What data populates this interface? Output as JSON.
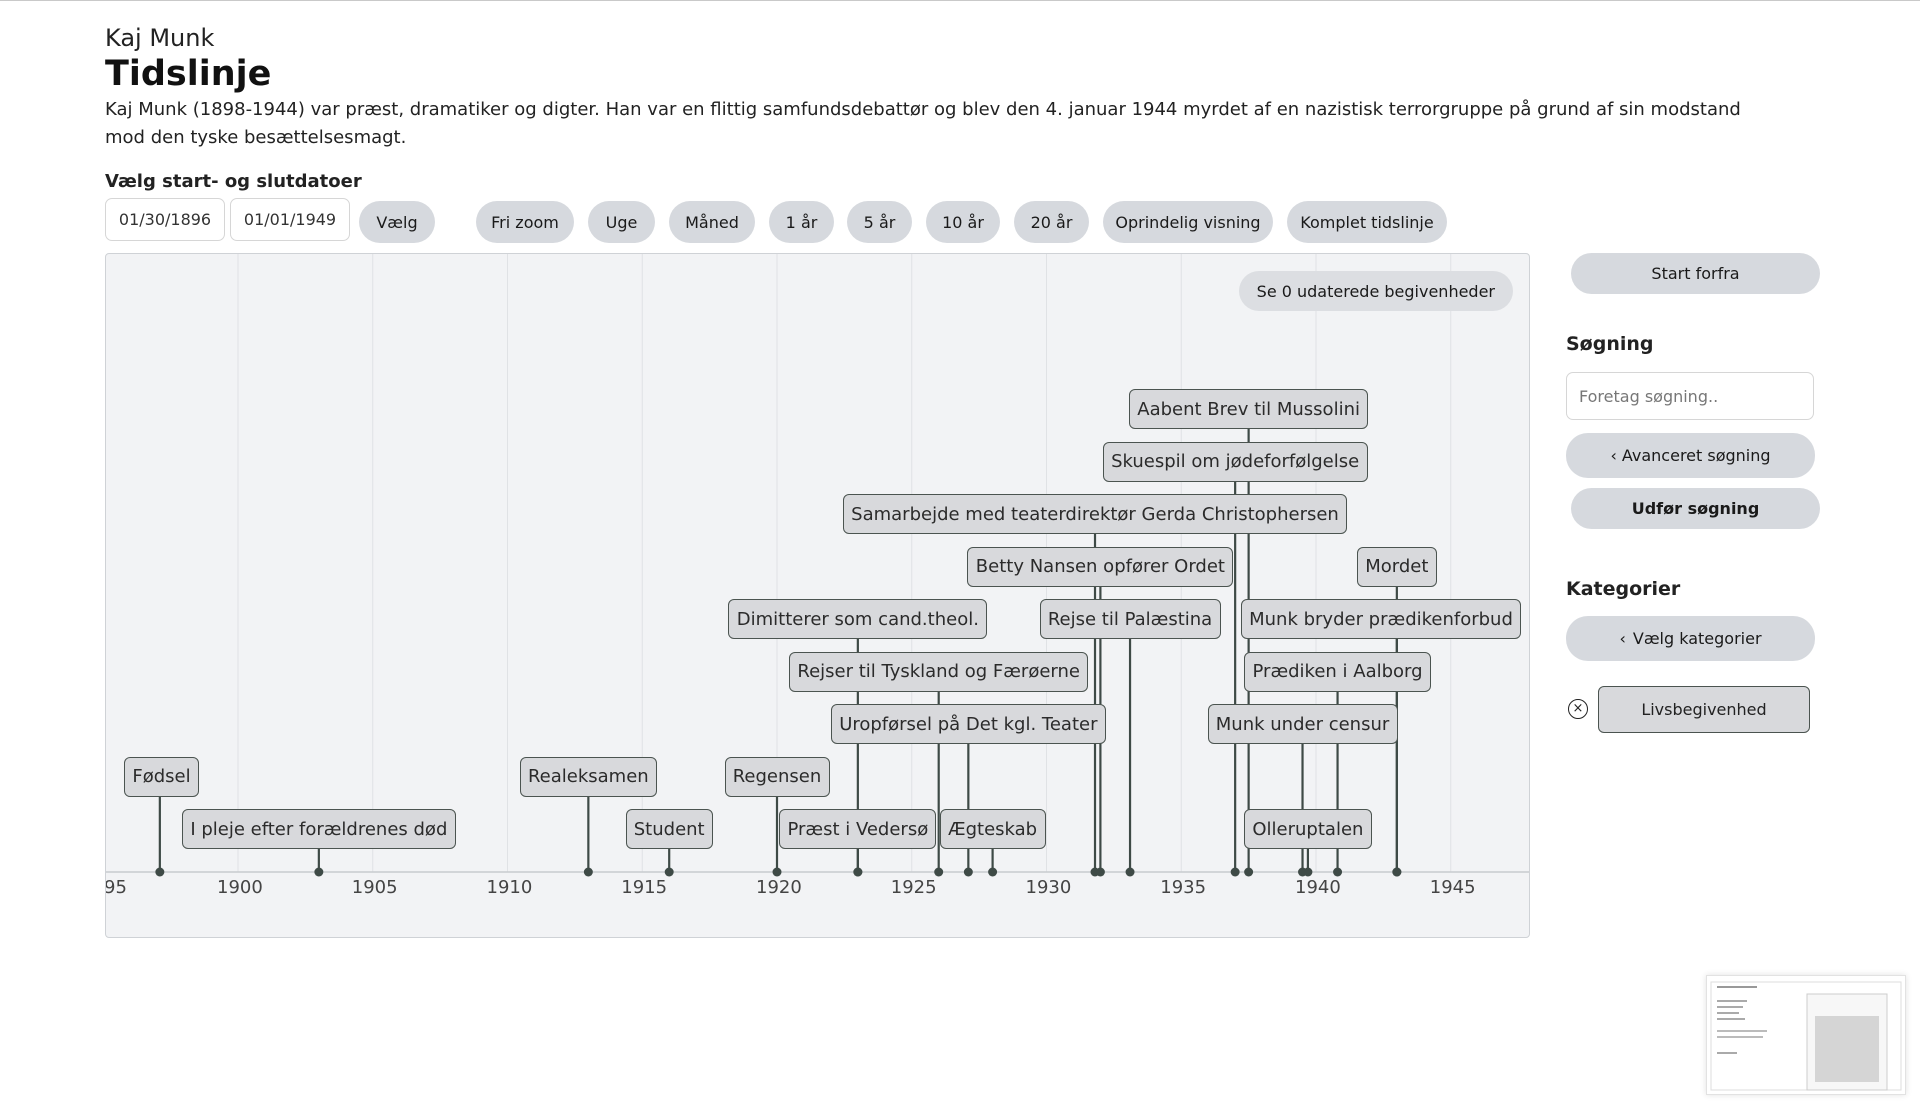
{
  "header": {
    "subtitle": "Kaj Munk",
    "title": "Tidslinje",
    "description": "Kaj Munk (1898-1944) var præst, dramatiker og digter. Han var en flittig samfundsdebattør og blev den 4. januar 1944 myrdet af en nazistisk terrorgruppe på grund af sin modstand mod den tyske besættelsesmagt."
  },
  "date_range": {
    "label": "Vælg start- og slutdatoer",
    "start": "01/30/1896",
    "end": "01/01/1949",
    "select_button": "Vælg"
  },
  "zoom": {
    "buttons": [
      "Fri zoom",
      "Uge",
      "Måned",
      "1 år",
      "5 år",
      "10 år",
      "20 år",
      "Oprindelig visning",
      "Komplet tidslinje"
    ]
  },
  "timeline": {
    "undated_button": "Se 0 udaterede begivenheder",
    "axis_labels": [
      "95",
      "1900",
      "1905",
      "1910",
      "1915",
      "1920",
      "1925",
      "1930",
      "1935",
      "1940",
      "1945"
    ],
    "events": [
      {
        "label": "Fødsel",
        "year": 1897.1,
        "row": 1
      },
      {
        "label": "I pleje efter forældrenes død",
        "year": 1903.0,
        "row": 0
      },
      {
        "label": "Realeksamen",
        "year": 1913.0,
        "row": 1
      },
      {
        "label": "Student",
        "year": 1916.0,
        "row": 0
      },
      {
        "label": "Regensen",
        "year": 1920.0,
        "row": 1
      },
      {
        "label": "Præst i Vedersø",
        "year": 1923.0,
        "row": 0
      },
      {
        "label": "Dimitterer som cand.theol.",
        "year": 1923.0,
        "row": 4
      },
      {
        "label": "Rejser til Tyskland og Færøerne",
        "year": 1926.0,
        "row": 3
      },
      {
        "label": "Uropførsel på Det kgl. Teater",
        "year": 1927.1,
        "row": 2
      },
      {
        "label": "Ægteskab",
        "year": 1928.0,
        "row": 0
      },
      {
        "label": "Samarbejde med teaterdirektør Gerda Christophersen",
        "year": 1931.8,
        "row": 6
      },
      {
        "label": "Betty Nansen opfører Ordet",
        "year": 1932.0,
        "row": 5
      },
      {
        "label": "Rejse til Palæstina",
        "year": 1933.1,
        "row": 4
      },
      {
        "label": "Skuespil om jødeforfølgelse",
        "year": 1937.0,
        "row": 7
      },
      {
        "label": "Aabent Brev til Mussolini",
        "year": 1937.5,
        "row": 8
      },
      {
        "label": "Munk under censur",
        "year": 1939.5,
        "row": 2
      },
      {
        "label": "Olleruptalen",
        "year": 1939.7,
        "row": 0
      },
      {
        "label": "Prædiken i Aalborg",
        "year": 1940.8,
        "row": 3
      },
      {
        "label": "Munk bryder prædikenforbud",
        "year": 1943.0,
        "row": 4
      },
      {
        "label": "Mordet",
        "year": 1943.0,
        "row": 5
      }
    ]
  },
  "sidebar": {
    "guide_button": "Start forfra",
    "search_heading": "Søgning",
    "search_placeholder": "Foretag søgning..",
    "advanced_search": "Avanceret søgning",
    "execute_search": "Udfør søgning",
    "categories_heading": "Kategorier",
    "choose_categories": "Vælg kategorier",
    "active_category": "Livsbegivenhed"
  }
}
